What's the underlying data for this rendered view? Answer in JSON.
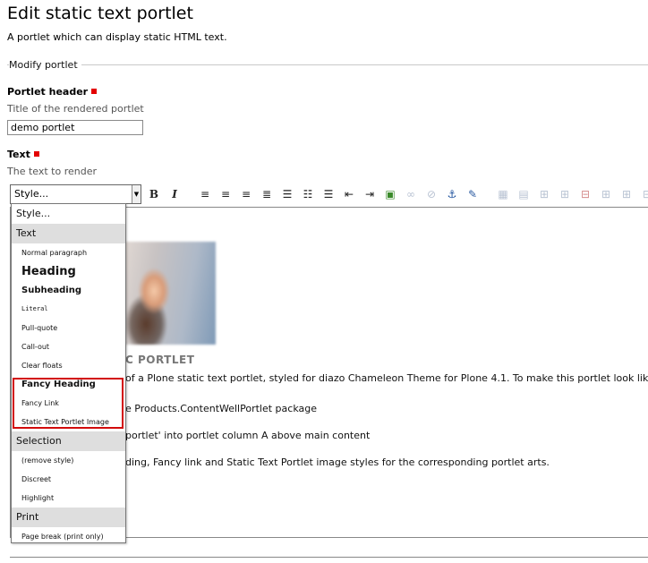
{
  "page": {
    "title": "Edit static text portlet",
    "description": "A portlet which can display static HTML text."
  },
  "fieldset": {
    "legend": "Modify portlet"
  },
  "portlet_header": {
    "label": "Portlet header",
    "help": "Title of the rendered portlet",
    "value": "demo portlet",
    "required": true
  },
  "text_field": {
    "label": "Text",
    "help": "The text to render",
    "required": true
  },
  "style_select": {
    "value": "Style..."
  },
  "toolbar": {
    "buttons": [
      {
        "icon": "bold-icon",
        "glyph": "B"
      },
      {
        "icon": "italic-icon",
        "glyph": "I"
      },
      {
        "icon": "align-left-icon",
        "glyph": "≡"
      },
      {
        "icon": "align-center-icon",
        "glyph": "≡"
      },
      {
        "icon": "align-right-icon",
        "glyph": "≡"
      },
      {
        "icon": "justify-icon",
        "glyph": "≡"
      },
      {
        "icon": "bullet-list-icon",
        "glyph": "☰"
      },
      {
        "icon": "numbered-list-icon",
        "glyph": "☷"
      },
      {
        "icon": "definition-list-icon",
        "glyph": "☰"
      },
      {
        "icon": "outdent-icon",
        "glyph": "⇤"
      },
      {
        "icon": "indent-icon",
        "glyph": "⇥"
      },
      {
        "icon": "insert-image-icon",
        "glyph": "▣"
      },
      {
        "icon": "insert-link-icon",
        "glyph": "∞"
      },
      {
        "icon": "unlink-icon",
        "glyph": "⊘"
      },
      {
        "icon": "anchor-icon",
        "glyph": "⚓"
      },
      {
        "icon": "edit-html-icon",
        "glyph": "✎"
      },
      {
        "icon": "insert-table-icon",
        "glyph": "▦"
      },
      {
        "icon": "table-properties-icon",
        "glyph": "▤"
      },
      {
        "icon": "row-before-icon",
        "glyph": "⊞"
      },
      {
        "icon": "row-after-icon",
        "glyph": "⊞"
      },
      {
        "icon": "delete-row-icon",
        "glyph": "⊟"
      },
      {
        "icon": "col-before-icon",
        "glyph": "⊞"
      },
      {
        "icon": "col-after-icon",
        "glyph": "⊞"
      },
      {
        "icon": "delete-col-icon",
        "glyph": "⊟"
      }
    ]
  },
  "editor": {
    "heading_fragment": "C PORTLET",
    "lines": [
      "of a Plone static text portlet, styled for diazo Chameleon Theme for Plone 4.1. To make this portlet look like th",
      "e Products.ContentWellPortlet package",
      "portlet' into portlet column A above main content",
      "ding, Fancy link and Static Text Portlet image styles for the corresponding portlet arts."
    ]
  },
  "dropdown": {
    "header": "Style...",
    "groups": [
      {
        "label": "Text",
        "items": [
          "Normal paragraph",
          "Heading",
          "Subheading",
          "Literal",
          "Pull-quote",
          "Call-out",
          "Clear floats",
          "Fancy Heading",
          "Fancy Link",
          "Static Text Portlet Image"
        ]
      },
      {
        "label": "Selection",
        "items": [
          "(remove style)",
          "Discreet",
          "Highlight"
        ]
      },
      {
        "label": "Print",
        "items": [
          "Page break (print only)"
        ]
      }
    ]
  },
  "colors": {
    "required_marker": "#e30000",
    "highlight_border": "#d20b0b",
    "group_bg": "#dedede"
  }
}
